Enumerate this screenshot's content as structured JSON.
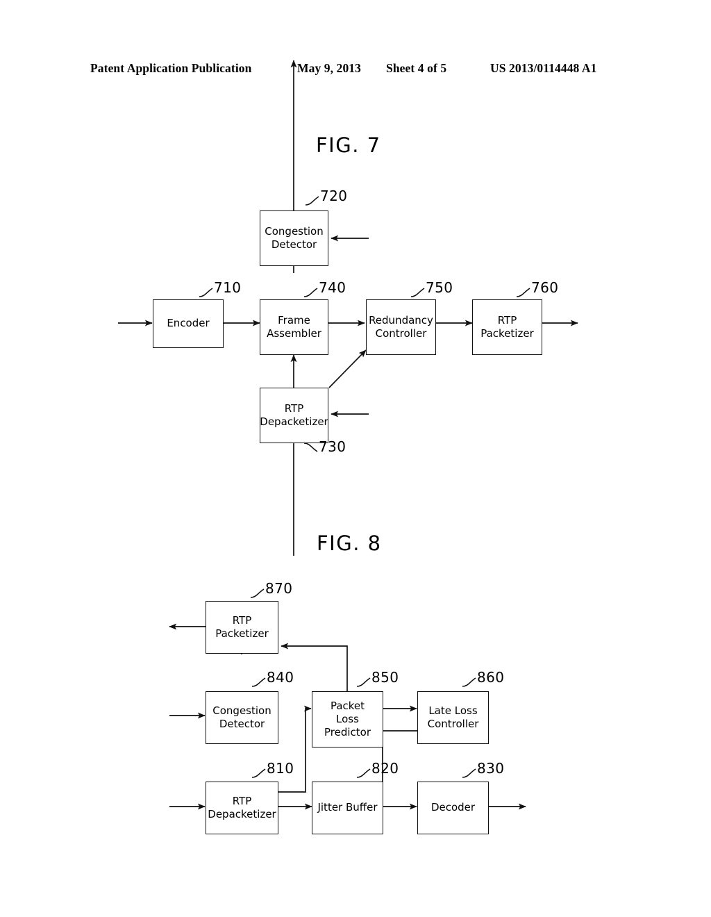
{
  "header": {
    "publication": "Patent Application Publication",
    "date": "May 9, 2013",
    "sheet": "Sheet 4 of 5",
    "number": "US 2013/0114448 A1"
  },
  "figures": [
    {
      "id": "fig7",
      "title": "FIG. 7",
      "nodes": [
        {
          "ref": "710",
          "label_lines": [
            "Encoder"
          ]
        },
        {
          "ref": "720",
          "label_lines": [
            "Congestion",
            "Detector"
          ]
        },
        {
          "ref": "730",
          "label_lines": [
            "RTP",
            "Depacketizer"
          ]
        },
        {
          "ref": "740",
          "label_lines": [
            "Frame",
            "Assembler"
          ]
        },
        {
          "ref": "750",
          "label_lines": [
            "Redundancy",
            "Controller"
          ]
        },
        {
          "ref": "760",
          "label_lines": [
            "RTP",
            "Packetizer"
          ]
        }
      ],
      "refs": [
        "710",
        "720",
        "730",
        "740",
        "750",
        "760"
      ]
    },
    {
      "id": "fig8",
      "title": "FIG. 8",
      "nodes": [
        {
          "ref": "810",
          "label_lines": [
            "RTP",
            "Depacketizer"
          ]
        },
        {
          "ref": "820",
          "label_lines": [
            "Jitter Buffer"
          ]
        },
        {
          "ref": "830",
          "label_lines": [
            "Decoder"
          ]
        },
        {
          "ref": "840",
          "label_lines": [
            "Congestion",
            "Detector"
          ]
        },
        {
          "ref": "850",
          "label_lines": [
            "Packet",
            "Loss",
            "Predictor"
          ]
        },
        {
          "ref": "860",
          "label_lines": [
            "Late Loss",
            "Controller"
          ]
        },
        {
          "ref": "870",
          "label_lines": [
            "RTP",
            "Packetizer"
          ]
        }
      ],
      "refs": [
        "810",
        "820",
        "830",
        "840",
        "850",
        "860",
        "870"
      ]
    }
  ],
  "fig7": {
    "title": "FIG. 7",
    "encoder": {
      "l1": "Encoder",
      "ref": "710"
    },
    "congestion_detector": {
      "l1": "Congestion",
      "l2": "Detector",
      "ref": "720"
    },
    "rtp_depacketizer": {
      "l1": "RTP",
      "l2": "Depacketizer",
      "ref": "730"
    },
    "frame_assembler": {
      "l1": "Frame",
      "l2": "Assembler",
      "ref": "740"
    },
    "redundancy_controller": {
      "l1": "Redundancy",
      "l2": "Controller",
      "ref": "750"
    },
    "rtp_packetizer": {
      "l1": "RTP",
      "l2": "Packetizer",
      "ref": "760"
    }
  },
  "fig8": {
    "title": "FIG. 8",
    "rtp_packetizer": {
      "l1": "RTP",
      "l2": "Packetizer",
      "ref": "870"
    },
    "congestion_detector": {
      "l1": "Congestion",
      "l2": "Detector",
      "ref": "840"
    },
    "packet_loss_predictor": {
      "l1": "Packet",
      "l2": "Loss",
      "l3": "Predictor",
      "ref": "850"
    },
    "late_loss_controller": {
      "l1": "Late Loss",
      "l2": "Controller",
      "ref": "860"
    },
    "rtp_depacketizer": {
      "l1": "RTP",
      "l2": "Depacketizer",
      "ref": "810"
    },
    "jitter_buffer": {
      "l1": "Jitter Buffer",
      "ref": "820"
    },
    "decoder": {
      "l1": "Decoder",
      "ref": "830"
    }
  },
  "colors": {
    "ink": "#000000",
    "paper": "#ffffff",
    "box_border": "#111111"
  }
}
